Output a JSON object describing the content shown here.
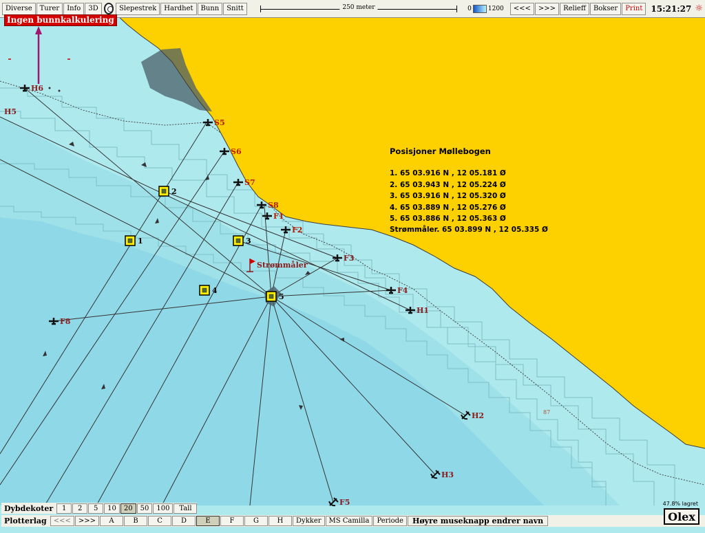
{
  "toolbar": {
    "buttons": [
      "Diverse",
      "Turer",
      "Info",
      "3D"
    ],
    "buttons2": [
      "Slepestrek",
      "Hardhet",
      "Bunn",
      "Snitt"
    ],
    "scale": "250 meter",
    "depth_min": "0",
    "depth_max": "1200",
    "nav_prev": "<<<",
    "nav_next": ">>>",
    "buttons3": [
      "Relieff",
      "Bokser"
    ],
    "print": "Print",
    "clock": "15:21:27"
  },
  "status": {
    "no_calc": "Ingen bunnkalkulering"
  },
  "info": {
    "title": "Posisjoner Møllebogen",
    "lines": [
      "1. 65 03.916 N , 12 05.181 Ø",
      "2. 65 03.943 N , 12 05.224 Ø",
      "3. 65 03.916 N , 12 05.320 Ø",
      "4. 65 03.889 N , 12 05.276 Ø",
      "5. 65 03.886 N , 12 05.363 Ø",
      "Strømmåler. 65 03.899 N , 12 05.335 Ø"
    ]
  },
  "map": {
    "positions": [
      "1",
      "2",
      "3",
      "4",
      "5"
    ],
    "current_meter": "Strømmåler",
    "anchors_t": [
      "H6",
      "S5",
      "S6",
      "S7",
      "S8",
      "F1",
      "F2",
      "F3",
      "F4",
      "H1",
      "F8"
    ],
    "anchors_a": [
      "H2",
      "H3",
      "F5"
    ],
    "label_h5": "H5",
    "depth_soundings": [
      "87"
    ],
    "colors": {
      "land": "#fdd000",
      "shallow": "#aee9ee",
      "mid": "#9fe1e8",
      "deep": "#8ed7e6",
      "box": "#fff000"
    }
  },
  "dybdekoter": {
    "label": "Dybdekoter",
    "values": [
      "1",
      "2",
      "5",
      "10",
      "20",
      "50",
      "100",
      "Tall"
    ],
    "selected": "20"
  },
  "plotterlag": {
    "label": "Plotterlag",
    "prev": "<<<",
    "next": ">>>",
    "layers": [
      "A",
      "B",
      "C",
      "D",
      "E",
      "F",
      "G",
      "H"
    ],
    "selected": "E",
    "extra": [
      "Dykker",
      "MS Camilla",
      "Periode"
    ],
    "hint": "Høyre museknapp endrer navn"
  },
  "saved": "47.8% lagret",
  "brand": "Olex"
}
